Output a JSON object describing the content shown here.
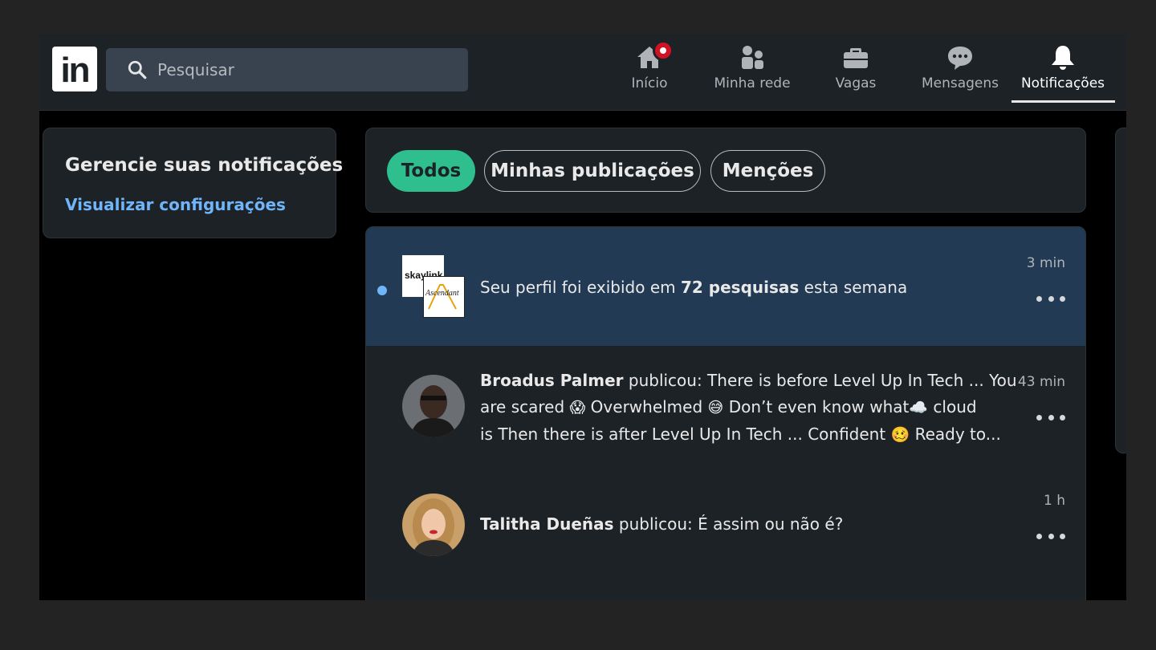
{
  "navbar": {
    "logo_text": "in",
    "search": {
      "placeholder": "Pesquisar",
      "value": ""
    },
    "items": [
      {
        "label": "Início",
        "icon": "home-icon",
        "active": false,
        "has_badge": true
      },
      {
        "label": "Minha rede",
        "icon": "network-icon",
        "active": false
      },
      {
        "label": "Vagas",
        "icon": "briefcase-icon",
        "active": false
      },
      {
        "label": "Mensagens",
        "icon": "messages-icon",
        "active": false
      },
      {
        "label": "Notificações",
        "icon": "bell-icon",
        "active": true
      }
    ]
  },
  "sidebar": {
    "title": "Gerencie suas notificações",
    "link": "Visualizar configurações"
  },
  "filters": {
    "items": [
      {
        "label": "Todos",
        "active": true
      },
      {
        "label": "Minhas publicações",
        "active": false
      },
      {
        "label": "Menções",
        "active": false
      }
    ]
  },
  "notifications": [
    {
      "text_before": "Seu perfil foi exibido em ",
      "text_bold": "72 pesquisas",
      "text_after": " esta semana",
      "time": "3 min",
      "unread": true,
      "logo_a_text": "skaylink",
      "logo_b_text": "Ascendant"
    },
    {
      "author": "Broadus Palmer",
      "line1": " publicou: There is before Level Up In Tech ... You",
      "line2_a": "are scared ",
      "emoji_1": "😱",
      "line2_b": " Overwhelmed ",
      "emoji_2": "😅",
      "line2_c": " Don’t even know what",
      "emoji_3": "☁️",
      "line2_d": " cloud",
      "line3_a": "is Then there is after Level Up In Tech ... Confident ",
      "emoji_4": "🥴",
      "line3_b": " Ready to...",
      "time": "43 min",
      "unread": false
    },
    {
      "author": "Talitha Dueñas",
      "text": " publicou: É assim ou não é?",
      "time": "1 h",
      "unread": false
    }
  ],
  "colors": {
    "accent_green": "#2fbf8e",
    "link_blue": "#70b5f9",
    "unread_bg": "#233a54",
    "badge_red": "#d11124",
    "card_bg": "#1d2226"
  }
}
